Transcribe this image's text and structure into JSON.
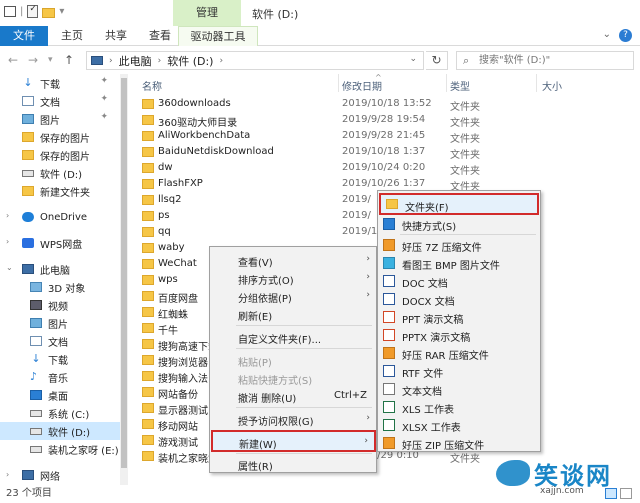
{
  "title_bar": {
    "manage_tab": "管理",
    "window_title": "软件 (D:)",
    "qat_separator": "|",
    "qat_dropdown": "▾"
  },
  "ribbon": {
    "tabs": [
      {
        "label": "文件"
      },
      {
        "label": "主页"
      },
      {
        "label": "共享"
      },
      {
        "label": "查看"
      },
      {
        "label": "驱动器工具"
      }
    ],
    "help": "?"
  },
  "address": {
    "root": "此电脑",
    "drive": "软件 (D:)",
    "search_placeholder": "搜索\"软件 (D:)\""
  },
  "nav_items": [
    {
      "label": "下载",
      "icon": "download-icon"
    },
    {
      "label": "文档",
      "icon": "document-icon"
    },
    {
      "label": "图片",
      "icon": "picture-icon"
    },
    {
      "label": "保存的图片",
      "icon": "folder-icon"
    },
    {
      "label": "保存的图片",
      "icon": "folder-icon"
    },
    {
      "label": "软件 (D:)",
      "icon": "drive-icon"
    },
    {
      "label": "新建文件夹",
      "icon": "folder-icon"
    },
    {
      "label": "OneDrive",
      "icon": "cloud-icon"
    },
    {
      "label": "WPS网盘",
      "icon": "wps-icon"
    },
    {
      "label": "此电脑",
      "icon": "computer-icon"
    },
    {
      "label": "3D 对象",
      "icon": "3d-icon"
    },
    {
      "label": "视频",
      "icon": "video-icon"
    },
    {
      "label": "图片",
      "icon": "picture-icon"
    },
    {
      "label": "文档",
      "icon": "document-icon"
    },
    {
      "label": "下载",
      "icon": "download-icon"
    },
    {
      "label": "音乐",
      "icon": "music-icon"
    },
    {
      "label": "桌面",
      "icon": "desktop-icon"
    },
    {
      "label": "系统 (C:)",
      "icon": "drive-icon"
    },
    {
      "label": "软件 (D:)",
      "icon": "drive-icon"
    },
    {
      "label": "装机之家呀 (E:)",
      "icon": "drive-icon"
    },
    {
      "label": "网络",
      "icon": "network-icon"
    }
  ],
  "columns": {
    "name": "名称",
    "date": "修改日期",
    "type": "类型",
    "size": "大小"
  },
  "files": [
    {
      "name": "360downloads",
      "date": "2019/10/18 13:52",
      "type": "文件夹"
    },
    {
      "name": "360驱动大师目录",
      "date": "2019/9/28 19:54",
      "type": "文件夹"
    },
    {
      "name": "AliWorkbenchData",
      "date": "2019/9/28 21:45",
      "type": "文件夹"
    },
    {
      "name": "BaiduNetdiskDownload",
      "date": "2019/10/18 1:37",
      "type": "文件夹"
    },
    {
      "name": "dw",
      "date": "2019/10/24 0:20",
      "type": "文件夹"
    },
    {
      "name": "FlashFXP",
      "date": "2019/10/26 1:37",
      "type": "文件夹"
    },
    {
      "name": "llsq2",
      "date": "2019/",
      "type": ""
    },
    {
      "name": "ps",
      "date": "2019/",
      "type": ""
    },
    {
      "name": "qq",
      "date": "2019/1",
      "type": ""
    },
    {
      "name": "waby",
      "date": "",
      "type": ""
    },
    {
      "name": "WeChat",
      "date": "",
      "type": ""
    },
    {
      "name": "wps",
      "date": "",
      "type": ""
    },
    {
      "name": "百度网盘",
      "date": "",
      "type": ""
    },
    {
      "name": "红蜘蛛",
      "date": "",
      "type": ""
    },
    {
      "name": "千牛",
      "date": "",
      "type": ""
    },
    {
      "name": "搜狗高速下载",
      "date": "",
      "type": ""
    },
    {
      "name": "搜狗浏览器",
      "date": "",
      "type": ""
    },
    {
      "name": "搜狗输入法",
      "date": "",
      "type": ""
    },
    {
      "name": "网站备份",
      "date": "",
      "type": ""
    },
    {
      "name": "显示器测试",
      "date": "",
      "type": ""
    },
    {
      "name": "移动网站",
      "date": "",
      "type": ""
    },
    {
      "name": "游戏测试",
      "date": "",
      "type": ""
    },
    {
      "name": "装机之家晓龙",
      "date": "2019/9/29 0:10",
      "type": "文件夹"
    }
  ],
  "status": {
    "count": "23 个项目"
  },
  "context_menu": {
    "items": [
      {
        "label": "查看(V)",
        "shortcut": "",
        "submenu": true,
        "disabled": false
      },
      {
        "label": "排序方式(O)",
        "shortcut": "",
        "submenu": true,
        "disabled": false
      },
      {
        "label": "分组依据(P)",
        "shortcut": "",
        "submenu": true,
        "disabled": false
      },
      {
        "label": "刷新(E)",
        "shortcut": "",
        "submenu": false,
        "disabled": false
      },
      {
        "label": "自定义文件夹(F)...",
        "shortcut": "",
        "submenu": false,
        "disabled": false
      },
      {
        "label": "粘贴(P)",
        "shortcut": "",
        "submenu": false,
        "disabled": true
      },
      {
        "label": "粘贴快捷方式(S)",
        "shortcut": "",
        "submenu": false,
        "disabled": true
      },
      {
        "label": "撤消 删除(U)",
        "shortcut": "Ctrl+Z",
        "submenu": false,
        "disabled": false
      },
      {
        "label": "授予访问权限(G)",
        "shortcut": "",
        "submenu": true,
        "disabled": false
      },
      {
        "label": "新建(W)",
        "shortcut": "",
        "submenu": true,
        "disabled": false
      },
      {
        "label": "属性(R)",
        "shortcut": "",
        "submenu": false,
        "disabled": false
      }
    ],
    "submenu_arrow": "›"
  },
  "new_submenu": {
    "items": [
      {
        "label": "文件夹(F)",
        "icon": "folder-icon"
      },
      {
        "label": "快捷方式(S)",
        "icon": "shortcut-icon"
      },
      {
        "label": "好压 7Z 压缩文件",
        "icon": "7z-archive-icon"
      },
      {
        "label": "看图王 BMP 图片文件",
        "icon": "bmp-image-icon"
      },
      {
        "label": "DOC 文档",
        "icon": "doc-file-icon"
      },
      {
        "label": "DOCX 文档",
        "icon": "docx-file-icon"
      },
      {
        "label": "PPT 演示文稿",
        "icon": "ppt-file-icon"
      },
      {
        "label": "PPTX 演示文稿",
        "icon": "pptx-file-icon"
      },
      {
        "label": "好压 RAR 压缩文件",
        "icon": "rar-archive-icon"
      },
      {
        "label": "RTF 文件",
        "icon": "rtf-file-icon"
      },
      {
        "label": "文本文档",
        "icon": "text-file-icon"
      },
      {
        "label": "XLS 工作表",
        "icon": "xls-file-icon"
      },
      {
        "label": "XLSX 工作表",
        "icon": "xlsx-file-icon"
      },
      {
        "label": "好压 ZIP 压缩文件",
        "icon": "zip-archive-icon"
      }
    ]
  },
  "watermark": {
    "text": "笑谈网",
    "url": "xajjn.com"
  }
}
